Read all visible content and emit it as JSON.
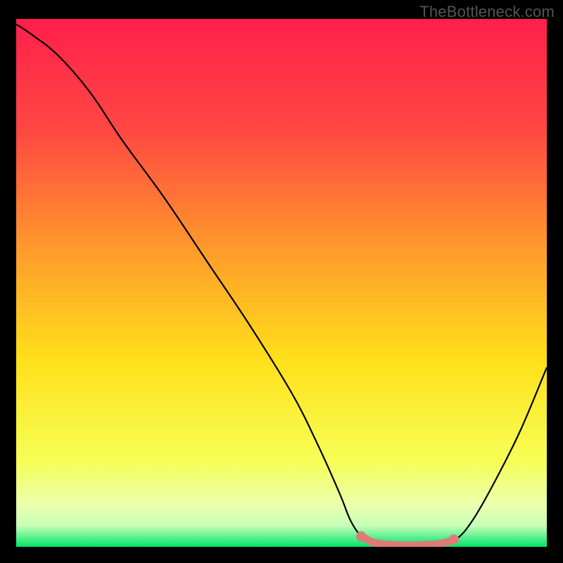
{
  "watermark": "TheBottleneck.com",
  "chart_data": {
    "type": "line",
    "title": "",
    "xlabel": "",
    "ylabel": "",
    "xlim": [
      0,
      100
    ],
    "ylim": [
      0,
      100
    ],
    "gradient_stops": [
      {
        "offset": 0,
        "color": "#ff1f4b"
      },
      {
        "offset": 22,
        "color": "#ff4a42"
      },
      {
        "offset": 45,
        "color": "#ff9f2a"
      },
      {
        "offset": 65,
        "color": "#ffe11a"
      },
      {
        "offset": 84,
        "color": "#f6ff57"
      },
      {
        "offset": 92,
        "color": "#ecffad"
      },
      {
        "offset": 96,
        "color": "#c7ffb8"
      },
      {
        "offset": 100,
        "color": "#00e46a"
      }
    ],
    "series": [
      {
        "name": "bottleneck-curve",
        "color": "#000000",
        "x": [
          0,
          3,
          8,
          14,
          20,
          28,
          36,
          44,
          52,
          57,
          61,
          63,
          65,
          67,
          70,
          74,
          78,
          80,
          83,
          86,
          90,
          95,
          100
        ],
        "y": [
          99,
          97,
          93,
          86,
          77,
          66,
          54,
          42,
          29,
          19,
          10,
          5,
          2,
          0.8,
          0.4,
          0.3,
          0.3,
          0.5,
          1.5,
          5,
          12,
          22,
          34
        ]
      }
    ],
    "markers": {
      "name": "highlight-band",
      "color": "#dd7b76",
      "points": [
        {
          "x": 65,
          "y": 2.0
        },
        {
          "x": 67,
          "y": 0.9
        },
        {
          "x": 69,
          "y": 0.5
        },
        {
          "x": 71,
          "y": 0.35
        },
        {
          "x": 73,
          "y": 0.3
        },
        {
          "x": 75,
          "y": 0.3
        },
        {
          "x": 77,
          "y": 0.35
        },
        {
          "x": 79,
          "y": 0.45
        },
        {
          "x": 80,
          "y": 0.6
        },
        {
          "x": 81.5,
          "y": 1.0
        },
        {
          "x": 82.5,
          "y": 1.4
        }
      ],
      "end_dots": [
        {
          "x": 65,
          "y": 2.0
        },
        {
          "x": 82.5,
          "y": 1.4
        }
      ]
    }
  }
}
